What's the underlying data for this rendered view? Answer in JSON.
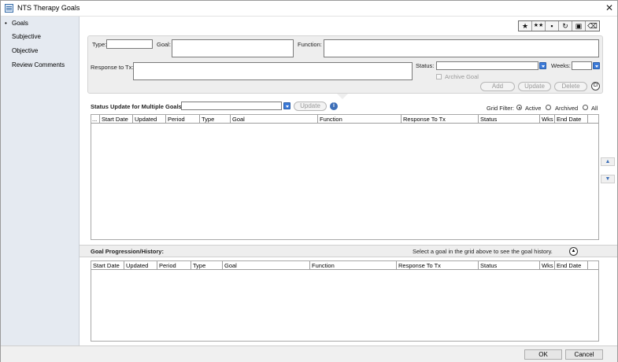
{
  "window": {
    "title": "NTS Therapy Goals",
    "close": "✕"
  },
  "sidebar": {
    "items": [
      {
        "label": "Goals",
        "active": true
      },
      {
        "label": "Subjective"
      },
      {
        "label": "Objective"
      },
      {
        "label": "Review Comments"
      }
    ]
  },
  "toolbar": {
    "icons": [
      "star-icon",
      "multi-star-icon",
      "save-icon",
      "refresh-icon",
      "clipboard-icon",
      "eraser-icon"
    ],
    "glyphs": [
      "★",
      "★★",
      "▪",
      "↻",
      "▣",
      "⌫"
    ]
  },
  "form": {
    "type_label": "Type:",
    "goal_label": "Goal:",
    "function_label": "Function:",
    "response_label": "Response to Tx:",
    "status_label": "Status:",
    "weeks_label": "Weeks:",
    "archive_label": "Archive Goal",
    "add": "Add",
    "update": "Update",
    "delete": "Delete",
    "clear": "Cl"
  },
  "status_update": {
    "label": "Status Update for Multiple Goals:",
    "update": "Update",
    "info": "i"
  },
  "grid_filter": {
    "label": "Grid Filter:",
    "options": [
      {
        "label": "Active",
        "selected": true
      },
      {
        "label": "Archived",
        "selected": false
      },
      {
        "label": "All",
        "selected": false
      }
    ]
  },
  "goals_grid": {
    "columns": [
      "...",
      "Start Date",
      "Updated",
      "Period",
      "Type",
      "Goal",
      "Function",
      "Response To Tx",
      "Status",
      "Wks",
      "End Date"
    ]
  },
  "history": {
    "title": "Goal Progression/History:",
    "hint": "Select a goal in the grid above to see the goal history.",
    "collapse": "▲",
    "columns": [
      "Start Date",
      "Updated",
      "Period",
      "Type",
      "Goal",
      "Function",
      "Response To Tx",
      "Status",
      "Wks",
      "End Date"
    ]
  },
  "side_arrows": {
    "up": "▲",
    "down": "▼"
  },
  "footer": {
    "ok": "OK",
    "cancel": "Cancel"
  }
}
